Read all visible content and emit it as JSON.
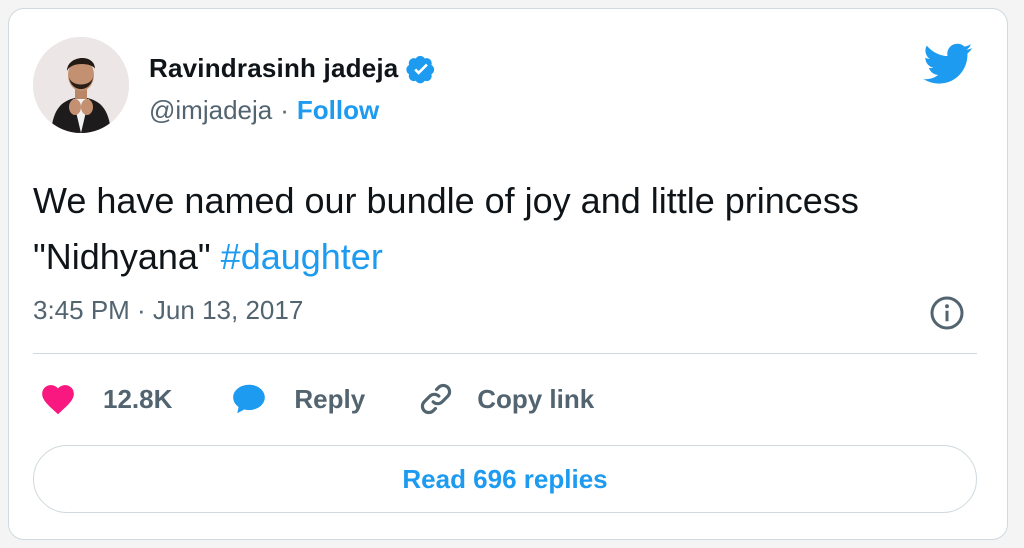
{
  "author": {
    "name": "Ravindrasinh jadeja",
    "handle": "@imjadeja",
    "separator": "·",
    "follow_label": "Follow",
    "verified": true
  },
  "tweet": {
    "text": "We have named our bundle of joy and little princess \"Nidhyana\" ",
    "hashtag": "#daughter",
    "timestamp": "3:45 PM · Jun 13, 2017"
  },
  "actions": {
    "like_count": "12.8K",
    "reply_label": "Reply",
    "copy_link_label": "Copy link"
  },
  "read_replies_label": "Read 696 replies",
  "icons": {
    "brand": "twitter-icon",
    "verified": "verified-badge-icon",
    "info": "info-icon",
    "like": "heart-icon",
    "reply": "speech-bubble-icon",
    "copy": "link-icon"
  },
  "colors": {
    "accent": "#1d9bf0",
    "like": "#f91880",
    "text": "#0f1419",
    "muted": "#536471",
    "border": "#cfd9de"
  }
}
